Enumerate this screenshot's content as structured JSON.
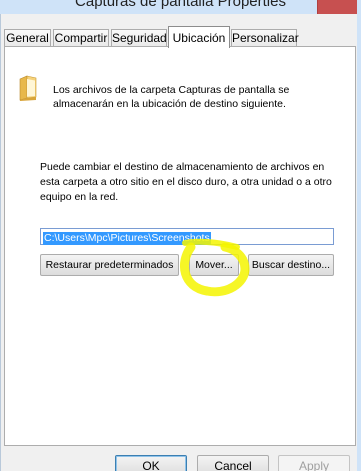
{
  "window": {
    "title": "Capturas de pantalla Properties"
  },
  "tabs": [
    {
      "label": "General"
    },
    {
      "label": "Compartir"
    },
    {
      "label": "Seguridad"
    },
    {
      "label": "Ubicación",
      "active": true
    },
    {
      "label": "Personalizar"
    }
  ],
  "location": {
    "description": "Los archivos de la carpeta Capturas de pantalla se almacenarán en la ubicación de destino siguiente.",
    "hint": "Puede cambiar el destino de almacenamiento de archivos en esta carpeta a otro sitio en el disco duro, a otra unidad o a otro equipo en la red.",
    "path": "C:\\Users\\Mpc\\Pictures\\Screenshots",
    "restore_button": "Restaurar predeterminados",
    "move_button": "Mover...",
    "find_button": "Buscar destino..."
  },
  "footer": {
    "ok": "OK",
    "cancel": "Cancel",
    "apply": "Apply"
  },
  "colors": {
    "selection": "#3399ff",
    "annotation": "#f5f500",
    "close_button": "#c75050"
  },
  "icons": {
    "folder": "folder-icon",
    "close": "close-icon"
  }
}
